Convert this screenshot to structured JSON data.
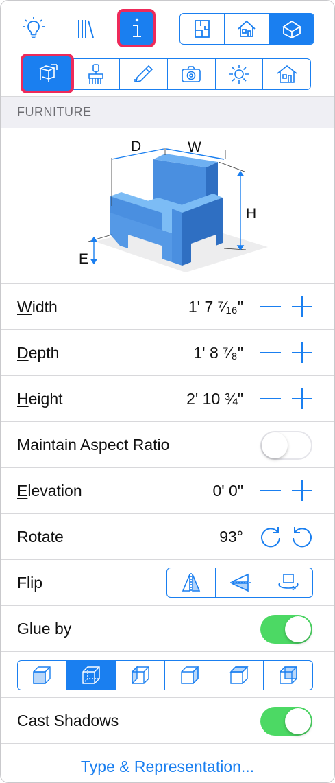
{
  "toolbar": {
    "icons": [
      "lightbulb-icon",
      "library-icon",
      "info-icon"
    ],
    "view_modes": [
      "floor-plan-2d-icon",
      "elevation-icon",
      "3d-view-icon"
    ],
    "selected_view": "3d-view-icon"
  },
  "subtoolbar": {
    "tabs": [
      "furniture-dimensions-icon",
      "materials-icon",
      "edit-icon",
      "camera-icon",
      "light-icon",
      "building-icon"
    ],
    "selected": "furniture-dimensions-icon"
  },
  "section": {
    "title": "FURNITURE"
  },
  "illustration": {
    "labels": {
      "depth": "D",
      "width": "W",
      "height": "H",
      "elevation": "E"
    }
  },
  "properties": {
    "width": {
      "label_first": "W",
      "label_rest": "idth",
      "value": "1' 7 ⁷⁄₁₆\""
    },
    "depth": {
      "label_first": "D",
      "label_rest": "epth",
      "value": "1' 8 ⁷⁄₈\""
    },
    "height": {
      "label_first": "H",
      "label_rest": "eight",
      "value": "2' 10 ¾\""
    },
    "aspect": {
      "label": "Maintain Aspect Ratio",
      "on": false
    },
    "elevation": {
      "label_first": "E",
      "label_rest": "levation",
      "value": "0' 0\""
    },
    "rotate": {
      "label": "Rotate",
      "value": "93°"
    },
    "flip": {
      "label": "Flip",
      "options": [
        "flip-horizontal-icon",
        "flip-vertical-icon",
        "rotate-3d-icon"
      ]
    },
    "glue": {
      "label": "Glue by",
      "on": true,
      "faces": [
        "cube-front-face-icon",
        "cube-bottom-face-icon",
        "cube-left-face-icon",
        "cube-right-face-icon",
        "cube-top-face-icon",
        "cube-back-face-icon"
      ],
      "selected_face": 1
    },
    "shadows": {
      "label": "Cast Shadows",
      "on": true
    }
  },
  "footer": {
    "link": "Type & Representation..."
  },
  "colors": {
    "accent": "#1a7ff0",
    "highlight": "#ee2a5a",
    "toggle_on": "#4cd964",
    "section_bg": "#efeff4"
  }
}
